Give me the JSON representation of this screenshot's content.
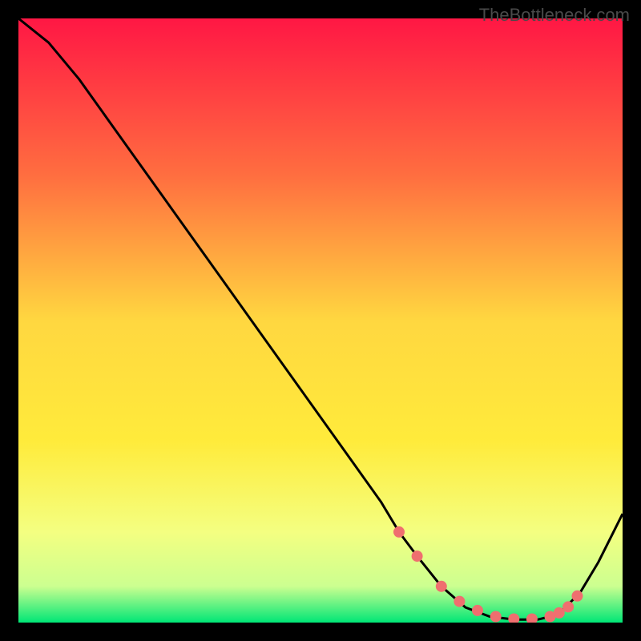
{
  "watermark": "TheBottleneck.com",
  "chart_data": {
    "type": "line",
    "title": "",
    "xlabel": "",
    "ylabel": "",
    "xlim": [
      0,
      100
    ],
    "ylim": [
      0,
      100
    ],
    "gradient_colors": {
      "top": "#ff1744",
      "mid_upper": "#ff8a3d",
      "mid": "#ffd740",
      "mid_lower": "#ffff72",
      "lower": "#eeff8a",
      "bottom": "#00e676"
    },
    "series": [
      {
        "name": "bottleneck-curve",
        "x": [
          0,
          5,
          10,
          15,
          20,
          25,
          30,
          35,
          40,
          45,
          50,
          55,
          60,
          63,
          66,
          70,
          74,
          78,
          82,
          86,
          88,
          90,
          93,
          96,
          100
        ],
        "y": [
          100,
          96,
          90,
          83,
          76,
          69,
          62,
          55,
          48,
          41,
          34,
          27,
          20,
          15,
          11,
          6,
          2.5,
          1,
          0.5,
          0.5,
          1,
          2,
          5,
          10,
          18
        ]
      }
    ],
    "marker_points": {
      "name": "highlight-dots",
      "color": "#ef6f6f",
      "x": [
        63,
        66,
        70,
        73,
        76,
        79,
        82,
        85,
        88,
        89.5,
        91,
        92.5
      ],
      "y": [
        15,
        11,
        6,
        3.5,
        2,
        1,
        0.6,
        0.6,
        1,
        1.6,
        2.6,
        4.4
      ]
    }
  }
}
